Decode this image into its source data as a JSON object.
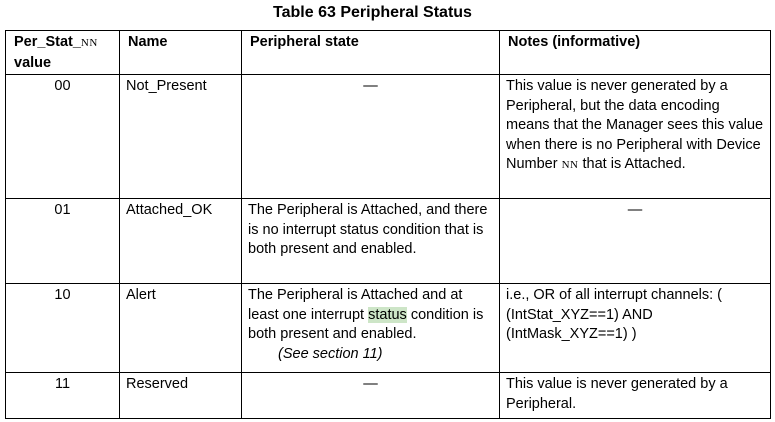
{
  "table": {
    "caption": "Table 63 Peripheral Status",
    "headers": {
      "value_prefix": "Per_Stat_",
      "value_nn": "NN",
      "value_suffix": "value",
      "name": "Name",
      "state": "Peripheral state",
      "notes": "Notes (informative)"
    },
    "rows": [
      {
        "value": "00",
        "name": "Not_Present",
        "state": "—",
        "notes_part1": "This value is never generated by a Peripheral, but the data encoding means that the Manager sees this value when there is no Peripheral with Device Number ",
        "notes_nn": "NN",
        "notes_part2": " that is Attached."
      },
      {
        "value": "01",
        "name": "Attached_OK",
        "state": "The Peripheral is Attached, and there is no interrupt status condition that is both present and enabled.",
        "notes": "—"
      },
      {
        "value": "10",
        "name": "Alert",
        "state_part1": "The Peripheral is Attached and at least one interrupt ",
        "state_highlight": "status",
        "state_part2": " condition is both present and enabled.",
        "state_ref": "(See section 11)",
        "notes": "i.e., OR of all interrupt channels: ( (IntStat_XYZ==1) AND (IntMask_XYZ==1) )"
      },
      {
        "value": "11",
        "name": "Reserved",
        "state": "—",
        "notes": "This value is never generated by a Peripheral."
      }
    ]
  },
  "colors": {
    "highlight": "#cde5c7",
    "border": "#000000"
  }
}
